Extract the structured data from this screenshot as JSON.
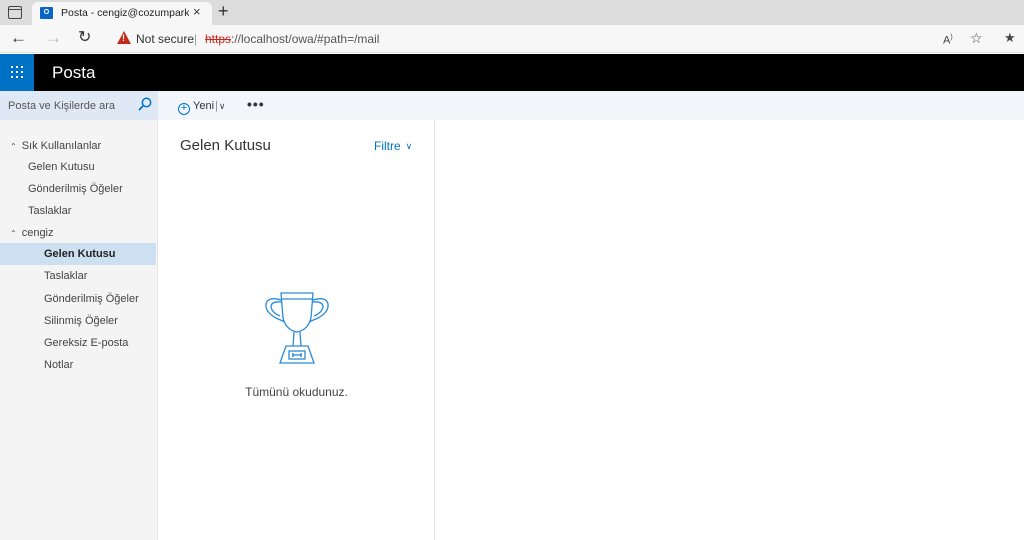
{
  "browser": {
    "tab_title": "Posta - cengiz@cozumpark.com",
    "tab_favicon": "O",
    "tab_close": "×",
    "new_tab": "+",
    "security_label": "Not secure",
    "url_scheme": "https",
    "url_rest": "://localhost/owa/#path=/mail",
    "icons": [
      "back-arrow-icon",
      "forward-arrow-icon",
      "reload-icon",
      "warning-icon",
      "read-aloud-icon",
      "add-favorite-icon",
      "favorites-bar-icon"
    ]
  },
  "header": {
    "app_title": "Posta",
    "accent_color": "#0072c6"
  },
  "search": {
    "placeholder": "Posta ve Kişilerde ara"
  },
  "toolbar": {
    "new_label": "Yeni",
    "more_label": "•••"
  },
  "nav": {
    "favorites_label": "Sık Kullanılanlar",
    "favorites": [
      "Gelen Kutusu",
      "Gönderilmiş Öğeler",
      "Taslaklar"
    ],
    "account_label": "cengiz",
    "folders": [
      "Gelen Kutusu",
      "Taslaklar",
      "Gönderilmiş Öğeler",
      "Silinmiş Öğeler",
      "Gereksiz E-posta",
      "Notlar"
    ],
    "selected_folder": "Gelen Kutusu"
  },
  "message_list": {
    "title": "Gelen Kutusu",
    "filter_label": "Filtre",
    "empty_message": "Tümünü okudunuz."
  }
}
